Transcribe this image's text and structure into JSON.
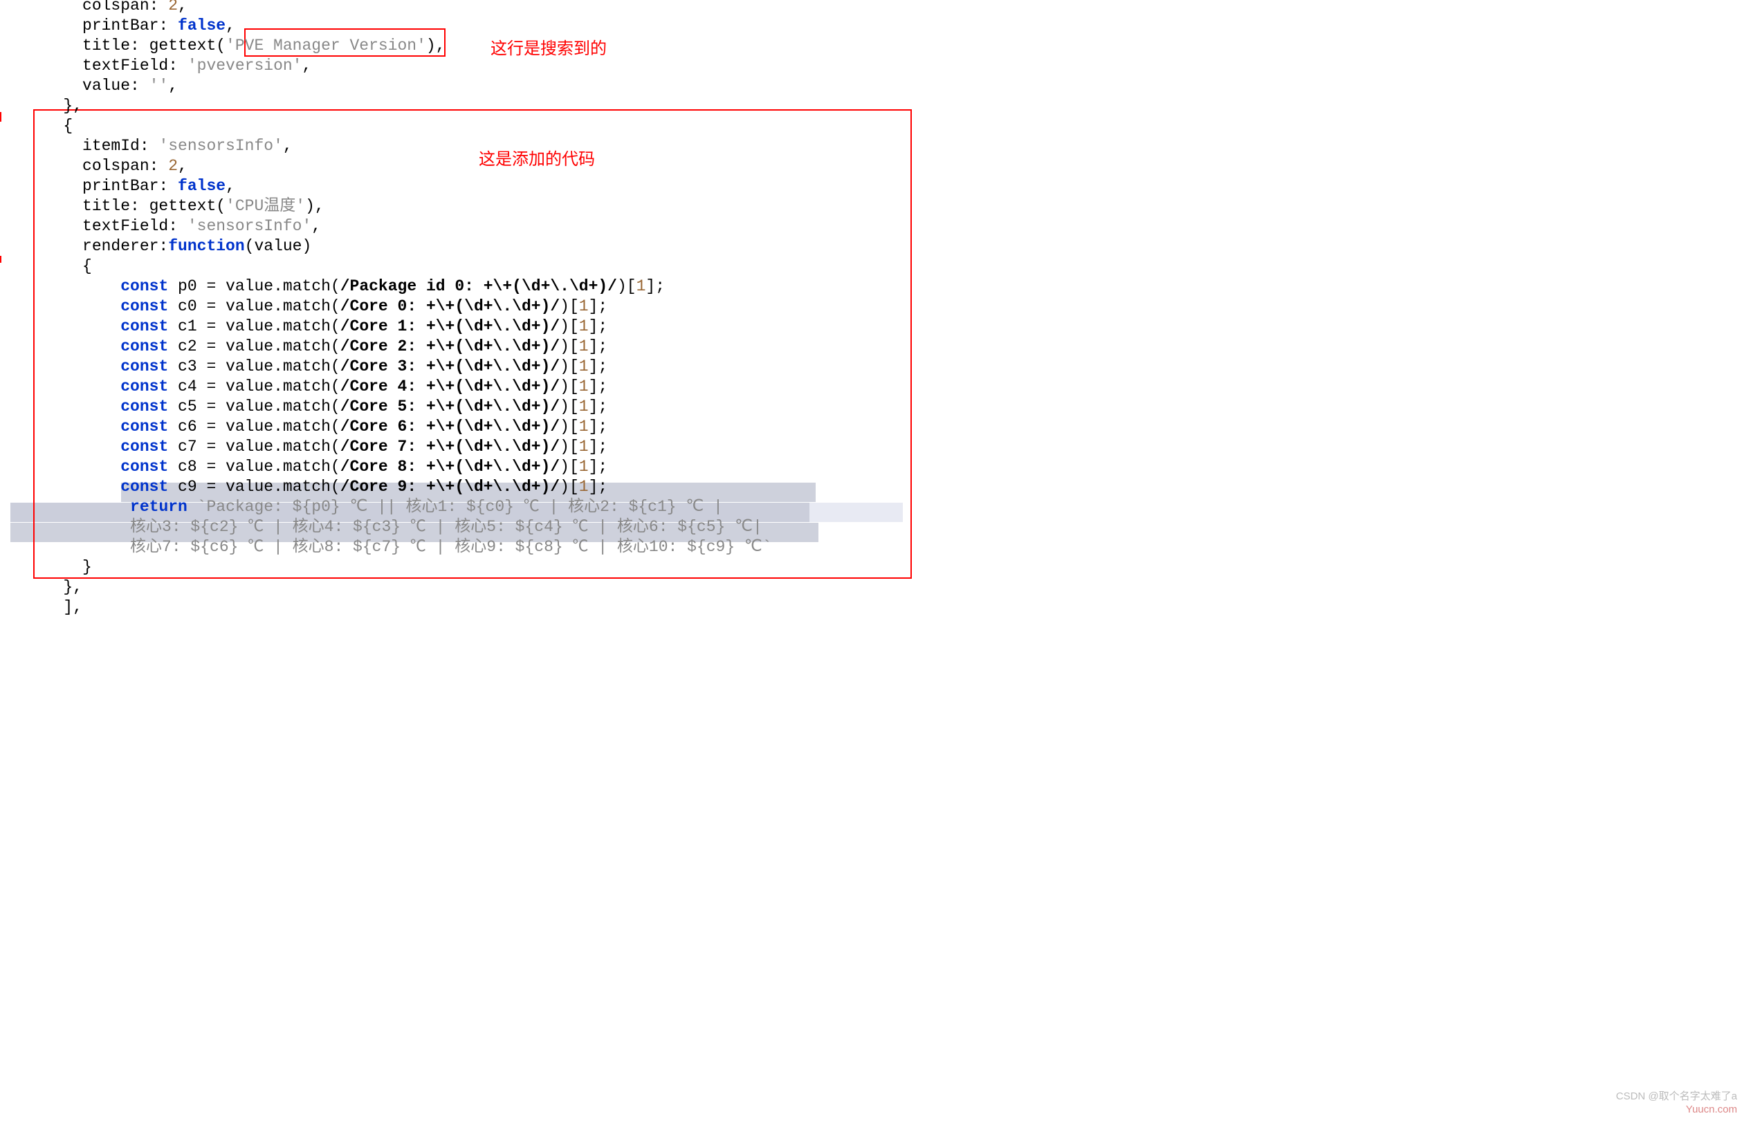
{
  "annotations": {
    "top": "这行是搜索到的",
    "mid": "这是添加的代码"
  },
  "watermarks": {
    "csdn": "CSDN @取个名字太难了a",
    "site": "Yuucn.com"
  },
  "code": {
    "block1": {
      "l1_a": "     colspan: ",
      "l1_num": "2",
      "l1_b": ",",
      "l2_a": "     printBar: ",
      "l2_kw": "false",
      "l2_b": ",",
      "l3_a": "     title: gettext(",
      "l3_s": "'PVE Manager Version'",
      "l3_b": "),",
      "l4_a": "     textField: ",
      "l4_s": "'pveversion'",
      "l4_b": ",",
      "l5_a": "     value: ",
      "l5_s": "''",
      "l5_b": ",",
      "l6": "   },"
    },
    "block2": {
      "l7": "   {",
      "l8_a": "     itemId: ",
      "l8_s": "'sensorsInfo'",
      "l8_b": ",",
      "l9_a": "     colspan: ",
      "l9_num": "2",
      "l9_b": ",",
      "l10_a": "     printBar: ",
      "l10_kw": "false",
      "l10_b": ",",
      "l11_a": "     title: gettext(",
      "l11_s": "'CPU温度'",
      "l11_b": "),",
      "l12_a": "     textField: ",
      "l12_s": "'sensorsInfo'",
      "l12_b": ",",
      "l13_a": "     renderer:",
      "l13_kw": "function",
      "l13_b": "(value)",
      "l14": "     {",
      "p_lead": "         ",
      "p_const": "const",
      "p_eq_match": " = value.match(",
      "p_tail_a": ")[",
      "p_tail_num": "1",
      "p_tail_b": "];",
      "vars": [
        {
          "v": "p0",
          "rx": "/Package id 0: +\\+(\\d+\\.\\d+)/"
        },
        {
          "v": "c0",
          "rx": "/Core 0: +\\+(\\d+\\.\\d+)/"
        },
        {
          "v": "c1",
          "rx": "/Core 1: +\\+(\\d+\\.\\d+)/"
        },
        {
          "v": "c2",
          "rx": "/Core 2: +\\+(\\d+\\.\\d+)/"
        },
        {
          "v": "c3",
          "rx": "/Core 3: +\\+(\\d+\\.\\d+)/"
        },
        {
          "v": "c4",
          "rx": "/Core 4: +\\+(\\d+\\.\\d+)/"
        },
        {
          "v": "c5",
          "rx": "/Core 5: +\\+(\\d+\\.\\d+)/"
        },
        {
          "v": "c6",
          "rx": "/Core 6: +\\+(\\d+\\.\\d+)/"
        },
        {
          "v": "c7",
          "rx": "/Core 7: +\\+(\\d+\\.\\d+)/"
        },
        {
          "v": "c8",
          "rx": "/Core 8: +\\+(\\d+\\.\\d+)/"
        },
        {
          "v": "c9",
          "rx": "/Core 9: +\\+(\\d+\\.\\d+)/"
        }
      ],
      "ret_lead": "          ",
      "ret_kw": "return",
      "ret_tpl_1": " `Package: ${p0} ℃ || 核心1: ${c0} ℃ | 核心2: ${c1} ℃ | ",
      "ret_tpl_2": "          核心3: ${c2} ℃ | 核心4: ${c3} ℃ | 核心5: ${c4} ℃ | 核心6: ${c5} ℃| ",
      "ret_tpl_3": "          核心7: ${c6} ℃ | 核心8: ${c7} ℃ | 核心9: ${c8} ℃ | 核心10: ${c9} ℃`",
      "l_close2": "     }",
      "l_close1": "   },",
      "l_close0": "   ],"
    }
  }
}
